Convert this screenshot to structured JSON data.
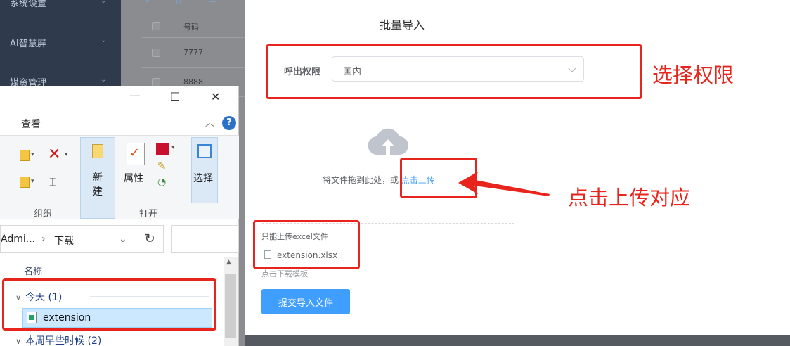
{
  "sidebar": {
    "items": [
      "系统设置",
      "AI智慧屏",
      "媒资管理"
    ]
  },
  "background_table": {
    "header": "号码",
    "rows": [
      "7777",
      "8888"
    ]
  },
  "dialog": {
    "title": "批量导入",
    "form_label": "呼出权限",
    "select_value": "国内",
    "upload_text": "将文件拖到此处，或",
    "upload_link": "点击上传",
    "tip": "只能上传excel文件",
    "file_name": "extension.xlsx",
    "template_link": "点击下载模板",
    "submit_label": "提交导入文件"
  },
  "annotations": {
    "select_permission": "选择权限",
    "click_upload": "点击上传对应"
  },
  "explorer": {
    "ribbon_tab": "查看",
    "groups": {
      "organize": "组织",
      "new": "新建",
      "open": "打开",
      "properties": "属性",
      "select": "选择"
    },
    "breadcrumb": [
      "Admi...",
      "下载"
    ],
    "column_name": "名称",
    "group_today": "今天 (1)",
    "file_name": "extension",
    "group_earlier": "本周早些时候 (2)"
  },
  "colors": {
    "accent": "#409eff",
    "annotation_red": "#e8251c",
    "sidebar_bg": "#2f3a4d",
    "selection_bg": "#cce8ff"
  }
}
